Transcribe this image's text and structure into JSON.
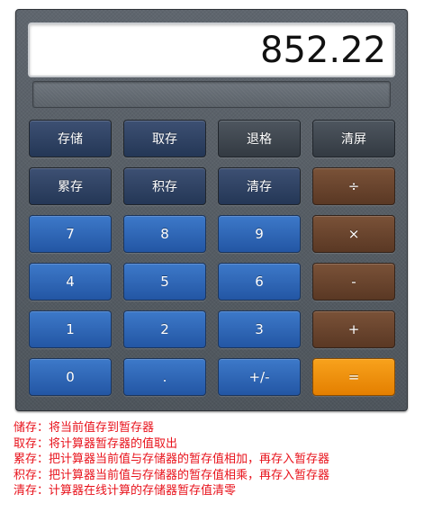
{
  "display": {
    "value": "852.22"
  },
  "buttons": {
    "row1": [
      "存储",
      "取存",
      "退格",
      "清屏"
    ],
    "row2": [
      "累存",
      "积存",
      "清存",
      "÷"
    ],
    "row3": [
      "7",
      "8",
      "9",
      "×"
    ],
    "row4": [
      "4",
      "5",
      "6",
      "-"
    ],
    "row5": [
      "1",
      "2",
      "3",
      "+"
    ],
    "row6": [
      "0",
      ".",
      "+/-",
      "="
    ]
  },
  "notes": [
    "储存：将当前值存到暂存器",
    "取存：将计算器暂存器的值取出",
    "累存：把计算器当前值与存储器的暂存值相加，再存入暂存器",
    "积存：把计算器当前值与存储器的暂存值相乘，再存入暂存器",
    "清存：计算器在线计算的存储器暂存值清零"
  ],
  "colors": {
    "memory_button": "#2c3f60",
    "function_button": "#3b424a",
    "digit_button": "#2f67b6",
    "operator_button": "#6b452e",
    "equals_button": "#ef8f0a",
    "notes_text": "#e8121b"
  }
}
